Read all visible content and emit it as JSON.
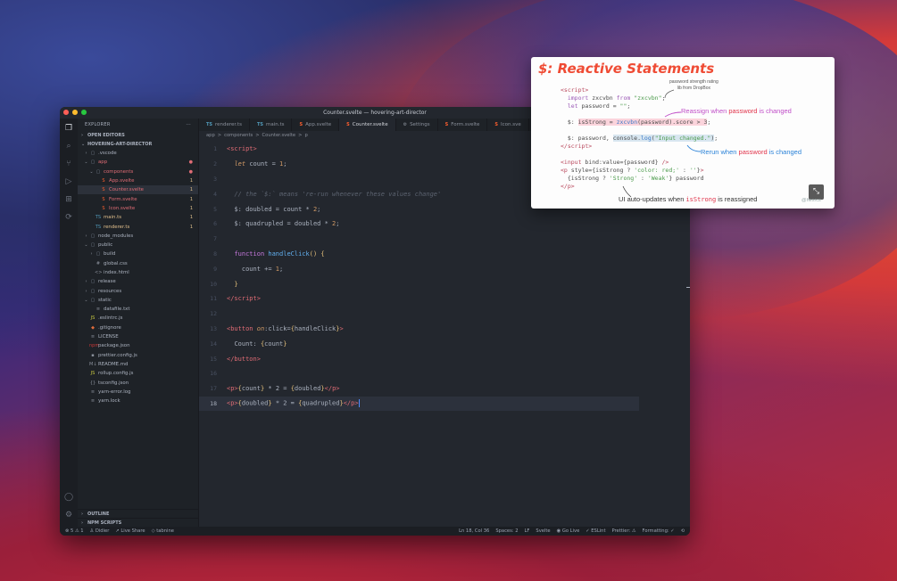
{
  "window": {
    "title": "Counter.svelte — hovering-art-director"
  },
  "sidebar": {
    "header": "EXPLORER",
    "more": "···",
    "open_editors": "OPEN EDITORS",
    "project": "HOVERING-ART-DIRECTOR",
    "outline": "OUTLINE",
    "npm_scripts": "NPM SCRIPTS",
    "tree": [
      {
        "indent": 0,
        "chev": "›",
        "icon": "▢",
        "label": ".vscode",
        "badge": "",
        "cls": ""
      },
      {
        "indent": 0,
        "chev": "⌄",
        "icon": "▢",
        "label": "app",
        "badge": "●",
        "cls": "err dot"
      },
      {
        "indent": 1,
        "chev": "⌄",
        "icon": "▢",
        "label": "components",
        "badge": "●",
        "cls": "err dot"
      },
      {
        "indent": 2,
        "chev": "",
        "icon": "S",
        "label": "App.svelte",
        "badge": "1",
        "cls": "err"
      },
      {
        "indent": 2,
        "chev": "",
        "icon": "S",
        "label": "Counter.svelte",
        "badge": "1",
        "cls": "sel err"
      },
      {
        "indent": 2,
        "chev": "",
        "icon": "S",
        "label": "Form.svelte",
        "badge": "1",
        "cls": "err"
      },
      {
        "indent": 2,
        "chev": "",
        "icon": "S",
        "label": "Icon.svelte",
        "badge": "1",
        "cls": "err"
      },
      {
        "indent": 1,
        "chev": "",
        "icon": "TS",
        "label": "main.ts",
        "badge": "1",
        "cls": "mod"
      },
      {
        "indent": 1,
        "chev": "",
        "icon": "TS",
        "label": "renderer.ts",
        "badge": "1",
        "cls": "mod"
      },
      {
        "indent": 0,
        "chev": "›",
        "icon": "▢",
        "label": "node_modules",
        "badge": "",
        "cls": ""
      },
      {
        "indent": 0,
        "chev": "⌄",
        "icon": "▢",
        "label": "public",
        "badge": "",
        "cls": ""
      },
      {
        "indent": 1,
        "chev": "›",
        "icon": "▢",
        "label": "build",
        "badge": "",
        "cls": ""
      },
      {
        "indent": 1,
        "chev": "",
        "icon": "#",
        "label": "global.css",
        "badge": "",
        "cls": ""
      },
      {
        "indent": 1,
        "chev": "",
        "icon": "<>",
        "label": "index.html",
        "badge": "",
        "cls": ""
      },
      {
        "indent": 0,
        "chev": "›",
        "icon": "▢",
        "label": "release",
        "badge": "",
        "cls": ""
      },
      {
        "indent": 0,
        "chev": "›",
        "icon": "▢",
        "label": "resources",
        "badge": "",
        "cls": ""
      },
      {
        "indent": 0,
        "chev": "⌄",
        "icon": "▢",
        "label": "static",
        "badge": "",
        "cls": ""
      },
      {
        "indent": 1,
        "chev": "",
        "icon": "≡",
        "label": "datafile.txt",
        "badge": "",
        "cls": ""
      },
      {
        "indent": 0,
        "chev": "",
        "icon": "JS",
        "label": ".eslintrc.js",
        "badge": "",
        "cls": ""
      },
      {
        "indent": 0,
        "chev": "",
        "icon": "◆",
        "label": ".gitignore",
        "badge": "",
        "cls": ""
      },
      {
        "indent": 0,
        "chev": "",
        "icon": "≡",
        "label": "LICENSE",
        "badge": "",
        "cls": ""
      },
      {
        "indent": 0,
        "chev": "",
        "icon": "npm",
        "label": "package.json",
        "badge": "",
        "cls": ""
      },
      {
        "indent": 0,
        "chev": "",
        "icon": "▪",
        "label": "prettier.config.js",
        "badge": "",
        "cls": ""
      },
      {
        "indent": 0,
        "chev": "",
        "icon": "M↓",
        "label": "README.md",
        "badge": "",
        "cls": ""
      },
      {
        "indent": 0,
        "chev": "",
        "icon": "JS",
        "label": "rollup.config.js",
        "badge": "",
        "cls": ""
      },
      {
        "indent": 0,
        "chev": "",
        "icon": "{}",
        "label": "tsconfig.json",
        "badge": "",
        "cls": ""
      },
      {
        "indent": 0,
        "chev": "",
        "icon": "≡",
        "label": "yarn-error.log",
        "badge": "",
        "cls": ""
      },
      {
        "indent": 0,
        "chev": "",
        "icon": "≡",
        "label": "yarn.lock",
        "badge": "",
        "cls": ""
      }
    ]
  },
  "tabs": [
    {
      "icon": "TS",
      "label": "renderer.ts",
      "active": false
    },
    {
      "icon": "TS",
      "label": "main.ts",
      "active": false
    },
    {
      "icon": "S",
      "label": "App.svelte",
      "active": false
    },
    {
      "icon": "S",
      "label": "Counter.svelte",
      "active": true
    },
    {
      "icon": "⚙",
      "label": "Settings",
      "active": false
    },
    {
      "icon": "S",
      "label": "Form.svelte",
      "active": false
    },
    {
      "icon": "S",
      "label": "Icon.sve",
      "active": false
    }
  ],
  "breadcrumb": [
    "app",
    ">",
    "components",
    ">",
    "Counter.svelte",
    ">",
    "p"
  ],
  "code_lines": [
    {
      "n": "1",
      "html": "<span class=\"tg\">&lt;script&gt;</span>"
    },
    {
      "n": "2",
      "html": "  <span class=\"at\">let</span> <span class=\"pl\">count = </span><span class=\"nm\">1</span><span class=\"pl\">;</span>"
    },
    {
      "n": "3",
      "html": ""
    },
    {
      "n": "4",
      "html": "  <span class=\"cm\">// the `$:` means 're-run whenever these values change'</span>"
    },
    {
      "n": "5",
      "html": "  <span class=\"pl\">$: doubled = count * </span><span class=\"nm\">2</span><span class=\"pl\">;</span>"
    },
    {
      "n": "6",
      "html": "  <span class=\"pl\">$: quadrupled = doubled * </span><span class=\"nm\">2</span><span class=\"pl\">;</span>"
    },
    {
      "n": "7",
      "html": ""
    },
    {
      "n": "8",
      "html": "  <span class=\"kw\">function</span> <span class=\"fn\">handleClick</span><span class=\"br\">()</span> <span class=\"br\">{</span>"
    },
    {
      "n": "9",
      "html": "    <span class=\"pl\">count += </span><span class=\"nm\">1</span><span class=\"pl\">;</span>"
    },
    {
      "n": "10",
      "html": "  <span class=\"br\">}</span>"
    },
    {
      "n": "11",
      "html": "<span class=\"tg\">&lt;/script&gt;</span>"
    },
    {
      "n": "12",
      "html": ""
    },
    {
      "n": "13",
      "html": "<span class=\"tg\">&lt;button</span> <span class=\"at\">on</span><span class=\"pl\">:click=</span><span class=\"br\">{</span><span class=\"pl\">handleClick</span><span class=\"br\">}</span><span class=\"tg\">&gt;</span>"
    },
    {
      "n": "14",
      "html": "  <span class=\"pl\">Count: </span><span class=\"br\">{</span><span class=\"pl\">count</span><span class=\"br\">}</span>"
    },
    {
      "n": "15",
      "html": "<span class=\"tg\">&lt;/button&gt;</span>"
    },
    {
      "n": "16",
      "html": ""
    },
    {
      "n": "17",
      "html": "<span class=\"tg\">&lt;p&gt;</span><span class=\"br\">{</span><span class=\"pl\">count</span><span class=\"br\">}</span><span class=\"pl\"> * 2 = </span><span class=\"br\">{</span><span class=\"pl\">doubled</span><span class=\"br\">}</span><span class=\"tg\">&lt;/p&gt;</span>"
    },
    {
      "n": "18",
      "html": "<span class=\"tg\">&lt;p&gt;</span><span class=\"br\">{</span><span class=\"pl\">doubled</span><span class=\"br\">}</span><span class=\"pl\"> * 2 = </span><span class=\"br\">{</span><span class=\"pl\">quadrupled</span><span class=\"br\">}</span><span class=\"tg\">&lt;/p&gt;</span><span class=\"cursor\"></span>",
      "current": true
    }
  ],
  "status": {
    "problems": "⊗ 5 ⚠ 1",
    "user": "Didier",
    "live_share": "Live Share",
    "tabnine": "tabnine",
    "position": "Ln 18, Col 36",
    "spaces": "Spaces: 2",
    "eol": "LF",
    "language": "Svelte",
    "go_live": "Go Live",
    "eslint": "✓ ESLint",
    "prettier": "Prettier: ⚠",
    "formatting": "Formatting: ✓"
  },
  "card": {
    "title": "$: Reactive Statements",
    "code": "<span class=\"cc-tag\">&lt;script&gt;</span>\n  <span class=\"cc-kw\">import</span> zxcvbn <span class=\"cc-kw\">from</span> <span class=\"cc-str\">\"zxcvbn\"</span>;\n  <span class=\"cc-kw\">let</span> password = <span class=\"cc-str\">\"\"</span>;\n\n  $: <span class=\"cc-hl\">isStrong = <span class=\"cc-fn\">zxcvbn</span>(password).score &gt; 3</span>;\n\n  $: password, <span class=\"cc-hl2\">console.<span class=\"cc-fn\">log</span>(<span class=\"cc-str\">\"Input changed.\"</span>)</span>;\n<span class=\"cc-tag\">&lt;/script&gt;</span>\n\n<span class=\"cc-tag\">&lt;input</span> bind:value={password} <span class=\"cc-tag\">/&gt;</span>\n<span class=\"cc-tag\">&lt;p</span> style={isStrong ? <span class=\"cc-str\">'color: red;'</span> : <span class=\"cc-str\">''</span>}<span class=\"cc-tag\">&gt;</span>\n  {isStrong ? <span class=\"cc-str\">'Strong'</span> : <span class=\"cc-str\">'Weak'</span>} password\n<span class=\"cc-tag\">&lt;/p&gt;</span>",
    "note_pw_1": "password strength rating",
    "note_pw_2": "lib from DropBox",
    "note_reassign_a": "Reassign when ",
    "note_reassign_b": "password",
    "note_reassign_c": " is changed",
    "note_rerun_a": "Rerun when ",
    "note_rerun_b": "password",
    "note_rerun_c": " is changed",
    "note_ui_a": "UI auto-updates when ",
    "note_ui_b": "isStrong",
    "note_ui_c": " is reassigned",
    "credit": "@hexrcs"
  }
}
